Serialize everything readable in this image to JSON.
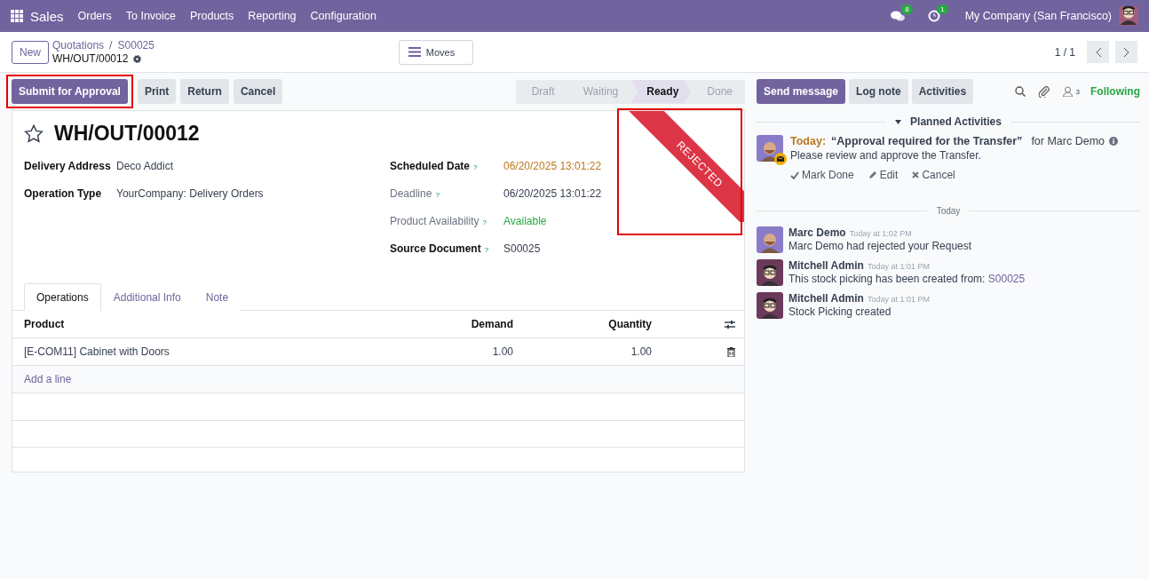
{
  "navbar": {
    "app": "Sales",
    "menu": [
      "Orders",
      "To Invoice",
      "Products",
      "Reporting",
      "Configuration"
    ],
    "messages_badge": "8",
    "activities_badge": "1",
    "company": "My Company (San Francisco)"
  },
  "control_panel": {
    "new_button": "New",
    "breadcrumbs": [
      "Quotations",
      "S00025"
    ],
    "breadcrumb_separator": "/",
    "record": "WH/OUT/00012",
    "smart_button": "Moves",
    "pager": "1 / 1"
  },
  "actions": [
    {
      "label": "Submit for Approval",
      "primary": true
    },
    {
      "label": "Print",
      "primary": false
    },
    {
      "label": "Return",
      "primary": false
    },
    {
      "label": "Cancel",
      "primary": false
    }
  ],
  "stages": [
    {
      "label": "Draft",
      "selected": false
    },
    {
      "label": "Waiting",
      "selected": false
    },
    {
      "label": "Ready",
      "selected": true
    },
    {
      "label": "Done",
      "selected": false
    }
  ],
  "form": {
    "title": "WH/OUT/00012",
    "starred": false,
    "ribbon": "REJECTED",
    "left_fields": [
      {
        "label": "Delivery Address",
        "value": "Deco Addict"
      },
      {
        "label": "Operation Type",
        "value": "YourCompany: Delivery Orders"
      }
    ],
    "right_fields": [
      {
        "label": "Scheduled Date",
        "help": "?",
        "value": "06/20/2025 13:01:22",
        "bold": true,
        "color": "#b7791f"
      },
      {
        "label": "Deadline",
        "help": "?",
        "value": "06/20/2025 13:01:22",
        "bold": false,
        "color": "#374151"
      },
      {
        "label": "Product Availability",
        "help": "?",
        "value": "Available",
        "bold": false,
        "color": "#28a745"
      },
      {
        "label": "Source Document",
        "help": "?",
        "value": "S00025",
        "bold": true,
        "color": "#374151"
      }
    ]
  },
  "tabs": [
    {
      "label": "Operations",
      "selected": true
    },
    {
      "label": "Additional Info",
      "selected": false
    },
    {
      "label": "Note",
      "selected": false
    }
  ],
  "table": {
    "columns": [
      "Product",
      "Demand",
      "Quantity"
    ],
    "rows": [
      [
        "[E-COM11] Cabinet with Doors",
        "1.00",
        "1.00"
      ]
    ],
    "add_line": "Add a line"
  },
  "chatter": {
    "buttons": [
      {
        "label": "Send message",
        "primary": true
      },
      {
        "label": "Log note",
        "primary": false
      },
      {
        "label": "Activities",
        "primary": false
      }
    ],
    "followers": "3",
    "following": "Following",
    "planned_title": "Planned Activities",
    "activity": {
      "due": "Today:",
      "summary": "“Approval required for the Transfer”",
      "assignee": "for Marc Demo",
      "note": "Please review and approve the Transfer.",
      "actions": [
        "Mark Done",
        "Edit",
        "Cancel"
      ]
    },
    "separator": "Today",
    "messages": [
      {
        "kind": "beard",
        "author": "Marc Demo",
        "time": "Today at 1:02 PM",
        "body": "Marc Demo had rejected your Request"
      },
      {
        "kind": "glasses",
        "author": "Mitchell Admin",
        "time": "Today at 1:01 PM",
        "body": "This stock picking has been created from: ",
        "link": "S00025"
      },
      {
        "kind": "glasses",
        "author": "Mitchell Admin",
        "time": "Today at 1:01 PM",
        "body": "Stock Picking created"
      }
    ]
  }
}
